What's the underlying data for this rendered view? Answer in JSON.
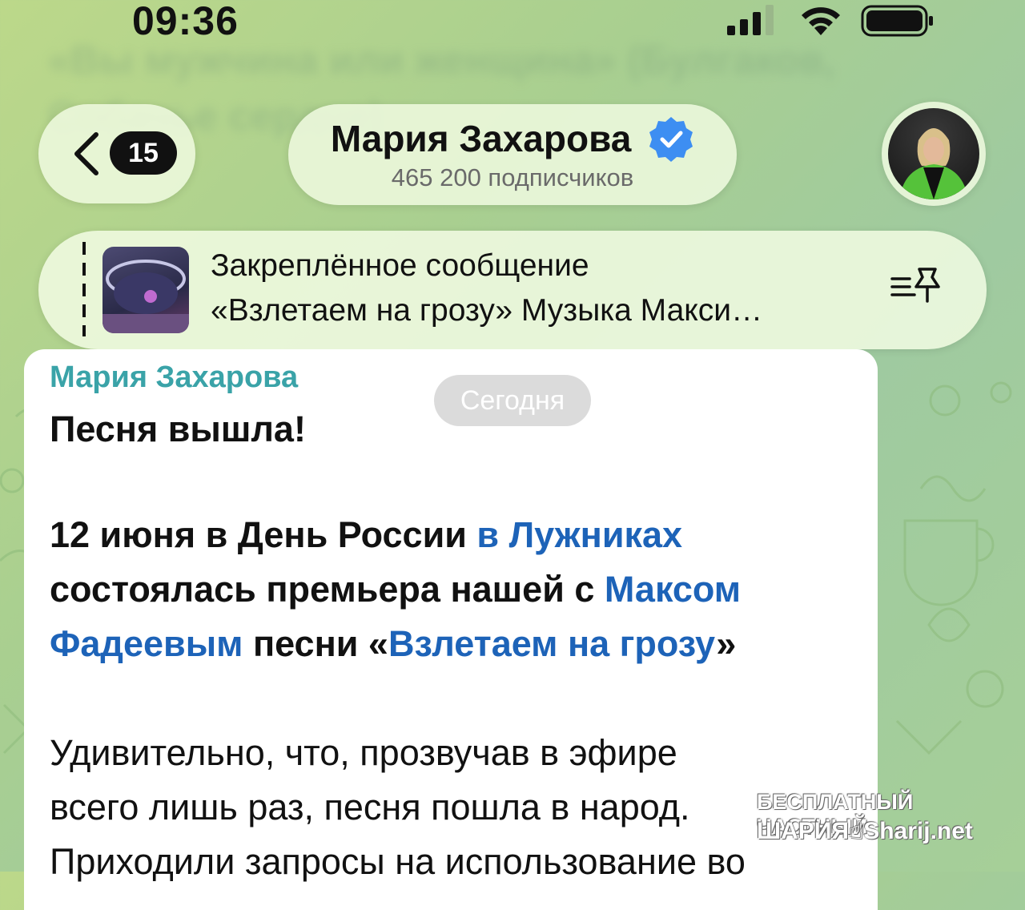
{
  "status_bar": {
    "time": "09:36"
  },
  "background_text": "«Вы мужчина или женщина» (Булгаков, Собачье сердце)",
  "header": {
    "back_count": "15",
    "channel_name": "Мария Захарова",
    "subscribers": "465 200 подписчиков",
    "verified": true
  },
  "pinned": {
    "title": "Закреплённое сообщение",
    "text": "«Взлетаем на грозу» Музыка Макси…"
  },
  "date_chip": "Сегодня",
  "message": {
    "author": "Мария Захарова",
    "headline": "Песня вышла!",
    "p1_a": "12 июня в День России ",
    "p1_link1": "в Лужниках",
    "p2_a": "состоялась премьера нашей с ",
    "p2_link": "Максом",
    "p3_link": "Фадеевым",
    "p3_a": " песни «",
    "p3_link2": "Взлетаем на грозу",
    "p3_b": "»",
    "p4": "Удивительно, что, прозвучав в эфире",
    "p5": "всего лишь раз, песня пошла в народ.",
    "p6": "Приходили запросы на использование во"
  },
  "watermark": {
    "line1": "БЕСПЛАТНЫЙ ЧАСТНЫЙ",
    "line2": "ШАРИЯ☝Sharij.net"
  },
  "colors": {
    "link": "#1d63b8",
    "author": "#3aa3a8",
    "verified": "#3d8ef2"
  }
}
